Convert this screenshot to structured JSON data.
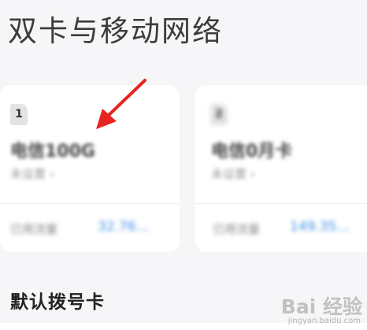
{
  "page_title": "双卡与移动网络",
  "sim_cards": [
    {
      "slot_label": "1",
      "name": "电信100G",
      "status": "未设置 ›",
      "usage_label": "已用流量",
      "usage_value": "32.76..."
    },
    {
      "slot_label": "2",
      "name": "电信0月卡",
      "status": "未设置 ›",
      "usage_label": "已用流量",
      "usage_value": "149.35..."
    }
  ],
  "section_title": "默认拨号卡",
  "watermark": {
    "brand": "Bai 经验",
    "url": "jingyan.baidu.com"
  },
  "colors": {
    "background": "#f6f6f8",
    "card": "#ffffff",
    "accent": "#3b8fe6",
    "arrow": "#e8241e"
  }
}
